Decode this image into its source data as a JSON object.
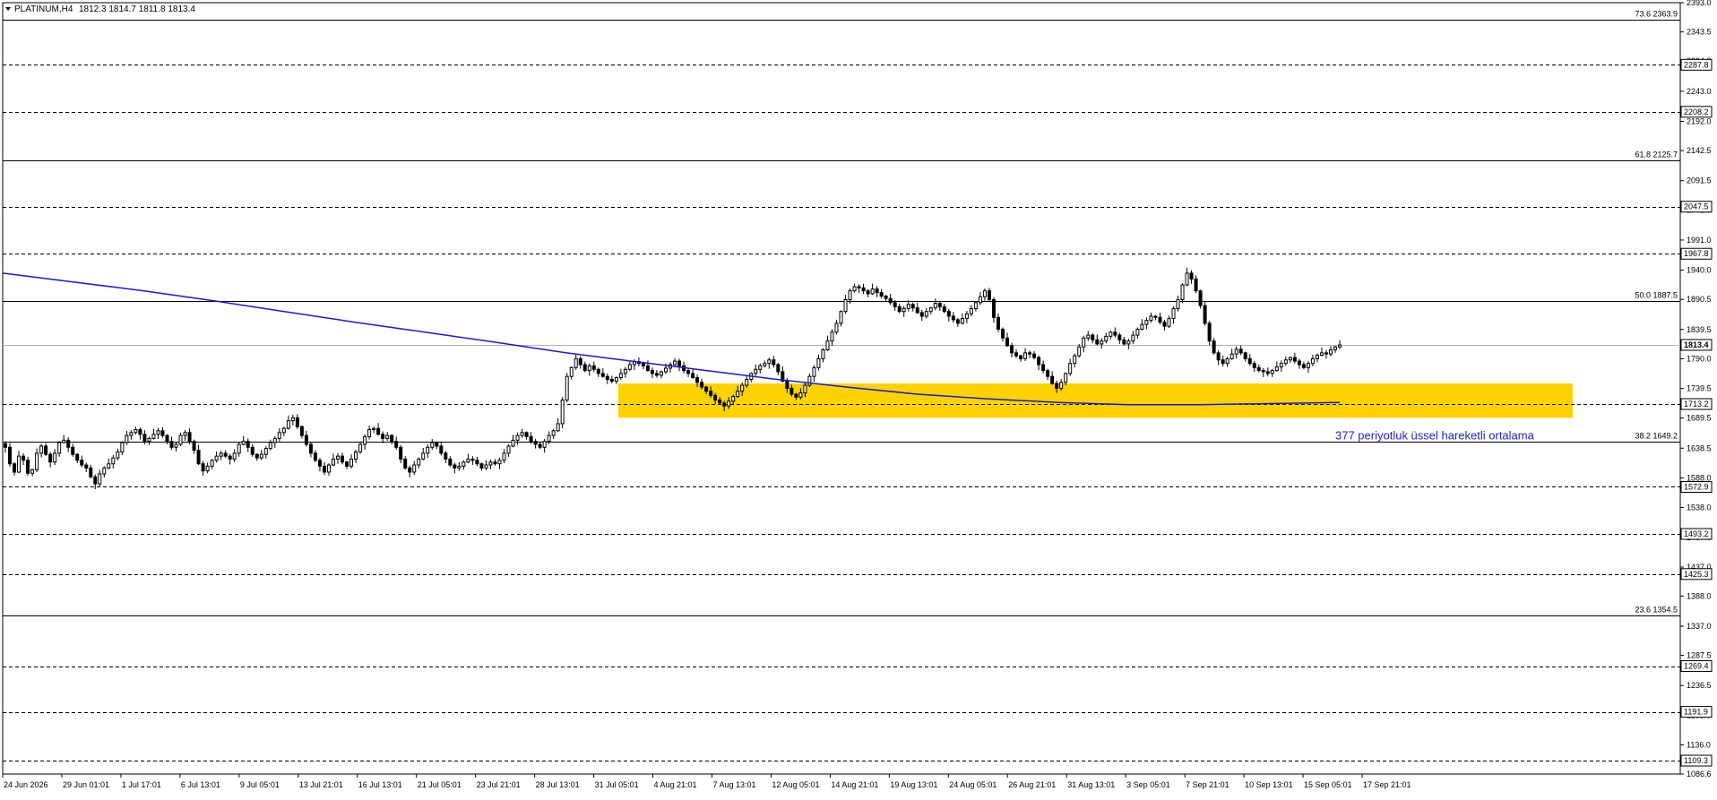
{
  "header": {
    "symbol_timeframe": "PLATINUM,H4",
    "ohlc": "1812.3 1814.7 1811.8 1813.4"
  },
  "chart_data": {
    "type": "candlestick",
    "title": "PLATINUM,H4",
    "ylim": [
      1086.6,
      2393.0
    ],
    "y_ticks": [
      "2393.0",
      "2343.5",
      "2294.0",
      "2243.0",
      "2192.0",
      "2142.5",
      "2091.5",
      "2041.5",
      "1991.0",
      "1940.0",
      "1890.5",
      "1839.5",
      "1790.0",
      "1739.5",
      "1689.5",
      "1638.5",
      "1588.0",
      "1538.0",
      "1487.0",
      "1437.0",
      "1388.0",
      "1337.0",
      "1287.5",
      "1236.5",
      "1186.0",
      "1136.0",
      "1086.6"
    ],
    "x_ticks": [
      "24 Jun 2026",
      "29 Jun 01:01",
      "1 Jul 17:01",
      "6 Jul 13:01",
      "9 Jul 05:01",
      "13 Jul 21:01",
      "16 Jul 13:01",
      "21 Jul 05:01",
      "23 Jul 21:01",
      "28 Jul 13:01",
      "31 Jul 05:01",
      "4 Aug 21:01",
      "7 Aug 13:01",
      "12 Aug 05:01",
      "14 Aug 21:01",
      "19 Aug 13:01",
      "24 Aug 05:01",
      "26 Aug 21:01",
      "31 Aug 13:01",
      "3 Sep 05:01",
      "7 Sep 21:01",
      "10 Sep 13:01",
      "15 Sep 05:01",
      "17 Sep 21:01"
    ],
    "current_price": 1813.4,
    "fib_levels": [
      {
        "label": "73.6 2363.9",
        "value": 2363.9
      },
      {
        "label": "61.8 2125.7",
        "value": 2125.7
      },
      {
        "label": "50.0 1887.5",
        "value": 1887.5
      },
      {
        "label": "38.2 1649.2",
        "value": 1649.2
      },
      {
        "label": "23.6 1354.5",
        "value": 1354.5
      }
    ],
    "horizontal_levels": [
      {
        "label": "2287.8",
        "value": 2287.8
      },
      {
        "label": "2208.2",
        "value": 2208.2
      },
      {
        "label": "2047.5",
        "value": 2047.5
      },
      {
        "label": "1967.8",
        "value": 1967.8
      },
      {
        "label": "1713.2",
        "value": 1713.2
      },
      {
        "label": "1572.9",
        "value": 1572.9
      },
      {
        "label": "1493.2",
        "value": 1493.2
      },
      {
        "label": "1425.3",
        "value": 1425.3
      },
      {
        "label": "1269.4",
        "value": 1269.4
      },
      {
        "label": "1191.9",
        "value": 1191.9
      },
      {
        "label": "1109.3",
        "value": 1109.3
      }
    ],
    "price_series_close": [
      1640,
      1612,
      1598,
      1625,
      1618,
      1596,
      1602,
      1630,
      1642,
      1628,
      1615,
      1630,
      1648,
      1652,
      1640,
      1628,
      1618,
      1610,
      1605,
      1590,
      1578,
      1595,
      1605,
      1612,
      1622,
      1632,
      1648,
      1660,
      1665,
      1670,
      1662,
      1650,
      1655,
      1662,
      1668,
      1660,
      1650,
      1640,
      1645,
      1660,
      1665,
      1650,
      1635,
      1612,
      1600,
      1608,
      1618,
      1625,
      1630,
      1625,
      1620,
      1630,
      1645,
      1650,
      1640,
      1628,
      1622,
      1628,
      1638,
      1648,
      1655,
      1665,
      1672,
      1685,
      1690,
      1675,
      1660,
      1645,
      1630,
      1618,
      1608,
      1598,
      1610,
      1620,
      1625,
      1615,
      1608,
      1620,
      1632,
      1645,
      1658,
      1670,
      1672,
      1662,
      1655,
      1660,
      1650,
      1640,
      1620,
      1605,
      1598,
      1610,
      1620,
      1630,
      1640,
      1648,
      1642,
      1630,
      1620,
      1610,
      1605,
      1608,
      1615,
      1620,
      1618,
      1612,
      1605,
      1610,
      1615,
      1612,
      1618,
      1630,
      1642,
      1652,
      1660,
      1665,
      1658,
      1650,
      1645,
      1640,
      1650,
      1660,
      1668,
      1680,
      1720,
      1760,
      1775,
      1790,
      1780,
      1770,
      1778,
      1772,
      1765,
      1760,
      1755,
      1752,
      1758,
      1765,
      1772,
      1780,
      1785,
      1782,
      1778,
      1770,
      1765,
      1762,
      1768,
      1774,
      1780,
      1786,
      1778,
      1770,
      1765,
      1758,
      1750,
      1742,
      1735,
      1728,
      1720,
      1715,
      1710,
      1718,
      1726,
      1735,
      1745,
      1755,
      1765,
      1772,
      1778,
      1782,
      1788,
      1780,
      1768,
      1752,
      1740,
      1730,
      1725,
      1732,
      1745,
      1760,
      1775,
      1790,
      1805,
      1820,
      1835,
      1850,
      1870,
      1890,
      1905,
      1912,
      1910,
      1905,
      1900,
      1908,
      1902,
      1896,
      1892,
      1885,
      1878,
      1870,
      1875,
      1882,
      1876,
      1868,
      1862,
      1870,
      1876,
      1884,
      1878,
      1870,
      1862,
      1856,
      1850,
      1858,
      1866,
      1875,
      1885,
      1895,
      1905,
      1890,
      1860,
      1840,
      1825,
      1812,
      1800,
      1795,
      1790,
      1800,
      1798,
      1792,
      1780,
      1770,
      1760,
      1748,
      1740,
      1750,
      1765,
      1782,
      1795,
      1810,
      1825,
      1830,
      1822,
      1815,
      1820,
      1828,
      1835,
      1830,
      1822,
      1815,
      1820,
      1830,
      1840,
      1848,
      1855,
      1862,
      1860,
      1852,
      1845,
      1858,
      1875,
      1890,
      1915,
      1935,
      1925,
      1905,
      1880,
      1850,
      1820,
      1800,
      1788,
      1782,
      1790,
      1798,
      1806,
      1800,
      1790,
      1782,
      1775,
      1770,
      1768,
      1765,
      1770,
      1776,
      1782,
      1788,
      1792,
      1786,
      1780,
      1775,
      1782,
      1790,
      1796,
      1800,
      1798,
      1805,
      1810,
      1813.4
    ],
    "series": [
      {
        "name": "377 periyotluk üssel hareketli ortalama",
        "values": [
          1935,
          1920,
          1905,
          1888,
          1870,
          1852,
          1835,
          1818,
          1800,
          1785,
          1770,
          1755,
          1742,
          1730,
          1722,
          1716,
          1712,
          1712,
          1714,
          1716
        ]
      }
    ],
    "support_zone": {
      "from": 1690,
      "to": 1748
    },
    "annotation": "377 periyotluk üssel hareketli ortalama",
    "colors": {
      "candle": "#000000",
      "ema": "#1a1ad2",
      "zone": "#ffd200",
      "level_line": "#000000",
      "current_line": "#b4b4b4",
      "annotation": "#2323c8"
    }
  }
}
